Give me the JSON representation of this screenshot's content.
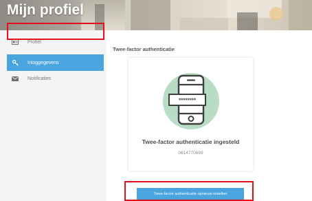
{
  "header": {
    "title": "Mijn profiel"
  },
  "sidebar": {
    "items": [
      {
        "label": "Profiel",
        "icon": "id-card-icon",
        "active": false
      },
      {
        "label": "Inloggegevens",
        "icon": "key-icon",
        "active": true
      },
      {
        "label": "Notificaties",
        "icon": "envelope-icon",
        "active": false
      }
    ]
  },
  "main": {
    "section_title": "Twee-factor authenticatie",
    "card": {
      "masked_code": "********",
      "heading": "Twee-factor authenticatie ingesteld",
      "phone": "0614770699"
    },
    "button_label": "Twee-factor authenticatie opnieuw instellen"
  },
  "colors": {
    "accent": "#4aa4de",
    "highlight": "#e3101a",
    "illustration_circle": "#b8dcc4",
    "sidebar_bg": "#f4f4f4"
  }
}
